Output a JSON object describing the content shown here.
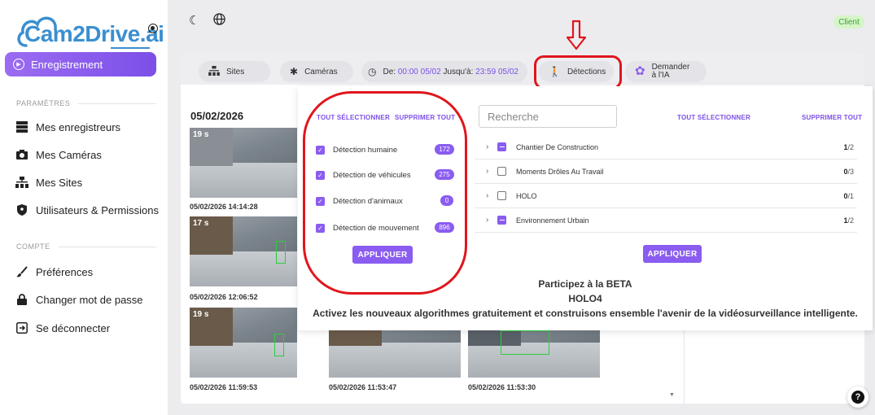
{
  "brand": {
    "name": "Cam2Drive.ai"
  },
  "sidebar": {
    "active_item": "Enregistrement",
    "section_params": "PARAMÈTRES",
    "section_account": "COMPTE",
    "items": [
      {
        "label": "Mes enregistreurs",
        "icon": "server-icon"
      },
      {
        "label": "Mes Caméras",
        "icon": "camera-icon"
      },
      {
        "label": "Mes Sites",
        "icon": "sitemap-icon"
      },
      {
        "label": "Utilisateurs & Permissions",
        "icon": "shield-icon"
      }
    ],
    "account_items": [
      {
        "label": "Préférences",
        "icon": "brush-icon"
      },
      {
        "label": "Changer mot de passe",
        "icon": "lock-icon"
      },
      {
        "label": "Se déconnecter",
        "icon": "logout-icon"
      }
    ]
  },
  "header": {
    "client_badge": "Client"
  },
  "filters": {
    "sites": "Sites",
    "cameras": "Caméras",
    "date_from_label": "De:",
    "date_from_value": "00:00 05/02",
    "date_to_label": "Jusqu'à:",
    "date_to_value": "23:59 05/02",
    "detections": "Détections",
    "ask_ai_line1": "Demander",
    "ask_ai_line2": "à l'IA"
  },
  "gallery": {
    "date_heading": "05/02/2026",
    "captions": [
      "05/02/2026 14:14:28",
      "05/02/2026 12:06:52",
      "05/02/2026 11:59:53",
      "05/02/2026 11:53:47",
      "05/02/2026 11:53:30"
    ],
    "overlay_19": "19 s",
    "overlay_17": "17 s",
    "overlay_19b": "19 s"
  },
  "detections_panel": {
    "select_all": "TOUT SÉLECTIONNER",
    "remove_all": "SUPPRIMER TOUT",
    "apply": "APPLIQUER",
    "items": [
      {
        "label": "Détection humaine",
        "count": "172",
        "checked": true
      },
      {
        "label": "Détection de véhicules",
        "count": "275",
        "checked": true
      },
      {
        "label": "Détection d'animaux",
        "count": "0",
        "checked": true
      },
      {
        "label": "Détection de mouvement",
        "count": "896",
        "checked": true
      }
    ]
  },
  "sites_panel": {
    "search_placeholder": "Recherche",
    "select_all": "TOUT SÉLECTIONNER",
    "remove_all": "SUPPRIMER TOUT",
    "apply": "APPLIQUER",
    "rows": [
      {
        "label": "Chantier De Construction",
        "selected": "1",
        "total": "/2",
        "state": "partial"
      },
      {
        "label": "Moments Drôles Au Travail",
        "selected": "0",
        "total": "/3",
        "state": "empty"
      },
      {
        "label": "HOLO",
        "selected": "0",
        "total": "/1",
        "state": "empty"
      },
      {
        "label": "Environnement Urbain",
        "selected": "1",
        "total": "/2",
        "state": "partial"
      }
    ]
  },
  "beta": {
    "title": "Participez à la BETA",
    "code": "HOLO4",
    "message": "Activez les nouveaux algorithmes gratuitement et construisons ensemble l'avenir de la vidéosurveillance intelligente."
  },
  "help": {
    "label": "?"
  },
  "colors": {
    "accent": "#8a5cf0",
    "highlight": "#e0161d",
    "brand": "#3a8fd0"
  }
}
